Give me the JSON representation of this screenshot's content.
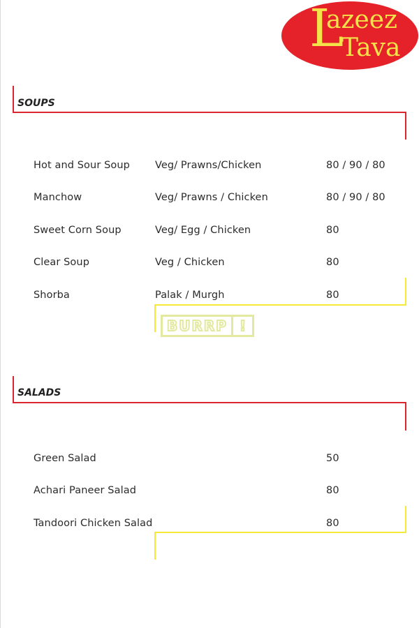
{
  "logo": {
    "line1": "azeez",
    "line2": "Tava",
    "initial": "L"
  },
  "watermark": {
    "text": "BURRP",
    "mark": "!"
  },
  "colors": {
    "accent_red": "#d8262c",
    "accent_yellow": "#f5ea36",
    "logo_red": "#e52229",
    "logo_yellow": "#f4e24a"
  },
  "sections": {
    "soups": {
      "title": "SOUPS",
      "items": [
        {
          "name": "Hot and Sour Soup",
          "variants": "Veg/ Prawns/Chicken",
          "price": "80 / 90 / 80"
        },
        {
          "name": "Manchow",
          "variants": "Veg/ Prawns / Chicken",
          "price": "80 / 90 / 80"
        },
        {
          "name": "Sweet Corn Soup",
          "variants": "Veg/ Egg / Chicken",
          "price": "80"
        },
        {
          "name": "Clear Soup",
          "variants": "Veg / Chicken",
          "price": "80"
        },
        {
          "name": "Shorba",
          "variants": "Palak / Murgh",
          "price": "80"
        }
      ]
    },
    "salads": {
      "title": "SALADS",
      "items": [
        {
          "name": "Green Salad",
          "price": "50"
        },
        {
          "name": "Achari Paneer Salad",
          "price": "80"
        },
        {
          "name": "Tandoori Chicken Salad",
          "price": "80"
        }
      ]
    }
  }
}
